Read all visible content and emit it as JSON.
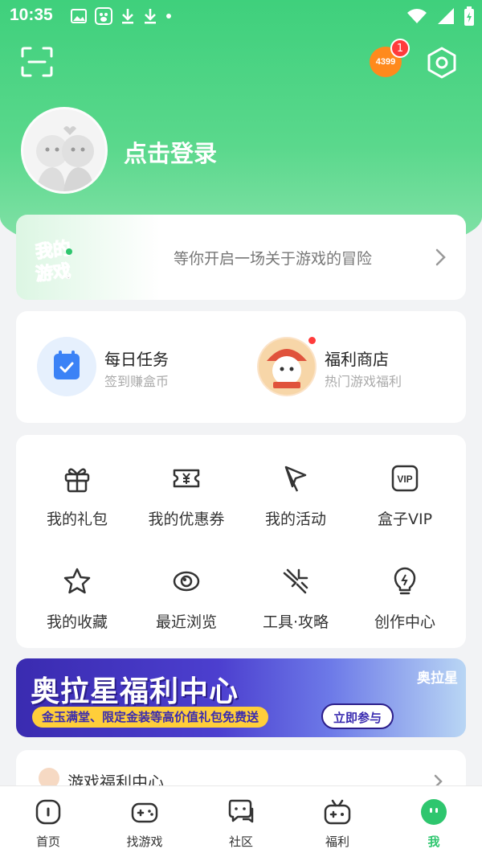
{
  "status_bar": {
    "time": "10:35"
  },
  "header": {
    "brand_badge": "4399",
    "notification_count": "1",
    "login_prompt": "点击登录"
  },
  "adventure_card": {
    "logo_text_line1": "我的",
    "logo_text_line2": "游戏",
    "text": "等你开启一场关于游戏的冒险"
  },
  "tasks": [
    {
      "title": "每日任务",
      "subtitle": "签到赚盒币"
    },
    {
      "title": "福利商店",
      "subtitle": "热门游戏福利"
    }
  ],
  "grid": [
    {
      "label": "我的礼包",
      "icon": "gift-icon"
    },
    {
      "label": "我的优惠券",
      "icon": "coupon-icon"
    },
    {
      "label": "我的活动",
      "icon": "flag-icon"
    },
    {
      "label": "盒子VIP",
      "icon": "vip-icon"
    },
    {
      "label": "我的收藏",
      "icon": "star-icon"
    },
    {
      "label": "最近浏览",
      "icon": "eye-icon"
    },
    {
      "label": "工具·攻略",
      "icon": "tools-icon"
    },
    {
      "label": "创作中心",
      "icon": "lightbulb-icon"
    }
  ],
  "banner": {
    "title": "奥拉星福利中心",
    "subtitle": "金玉满堂、限定金装等高价值礼包免费送",
    "button": "立即参与",
    "logo": "奥拉星"
  },
  "welfare_row": {
    "text": "游戏福利中心"
  },
  "tabbar": [
    {
      "label": "首页",
      "icon": "home-icon"
    },
    {
      "label": "找游戏",
      "icon": "gamepad-icon"
    },
    {
      "label": "社区",
      "icon": "chat-icon"
    },
    {
      "label": "福利",
      "icon": "gift-box-icon"
    },
    {
      "label": "我",
      "icon": "me-icon"
    }
  ],
  "colors": {
    "primary": "#2ec66e",
    "accent": "#ff8a1d",
    "badge": "#ff3b3b"
  }
}
